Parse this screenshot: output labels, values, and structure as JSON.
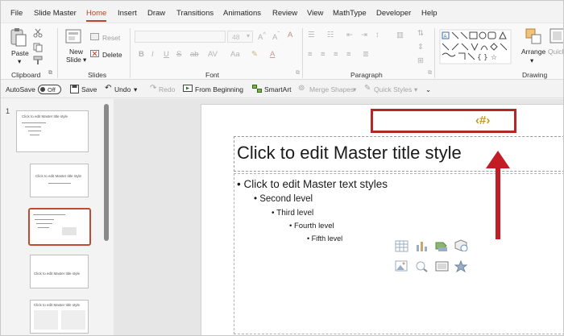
{
  "menu": {
    "tabs": [
      "File",
      "Slide Master",
      "Home",
      "Insert",
      "Draw",
      "Transitions",
      "Animations",
      "Review",
      "View",
      "MathType",
      "Developer",
      "Help"
    ],
    "active_tab": "Home"
  },
  "ribbon": {
    "clipboard": {
      "paste": "Paste",
      "group": "Clipboard"
    },
    "slides": {
      "new_slide_line1": "New",
      "new_slide_line2": "Slide",
      "reset": "Reset",
      "delete": "Delete",
      "group": "Slides"
    },
    "font": {
      "size": "48",
      "group": "Font"
    },
    "paragraph": {
      "group": "Paragraph"
    },
    "drawing": {
      "arrange": "Arrange",
      "quick_styles": "Quick Styles",
      "group": "Drawing"
    }
  },
  "qat": {
    "autosave": "AutoSave",
    "toggle_state": "Off",
    "save": "Save",
    "undo": "Undo",
    "redo": "Redo",
    "from_beginning": "From Beginning",
    "smartart": "SmartArt",
    "merge_shapes": "Merge Shapes",
    "quick_styles": "Quick Styles"
  },
  "thumbnails": {
    "first_number": "1",
    "thumb1_title": "Click to edit Master title style",
    "thumb2_title": "Click to edit Master title style",
    "thumb4_title": "Click to edit Master title style",
    "thumb5_title": "Click to edit Master title style"
  },
  "slide": {
    "title": "Click to edit Master title style",
    "levels": [
      "Click to edit Master text styles",
      "Second level",
      "Third level",
      "Fourth level",
      "Fifth level"
    ],
    "number_placeholder": "‹#›"
  },
  "colors": {
    "accent": "#b7472a",
    "highlight": "#b3272a",
    "arrow": "#c21d24",
    "number": "#c49a1e"
  }
}
